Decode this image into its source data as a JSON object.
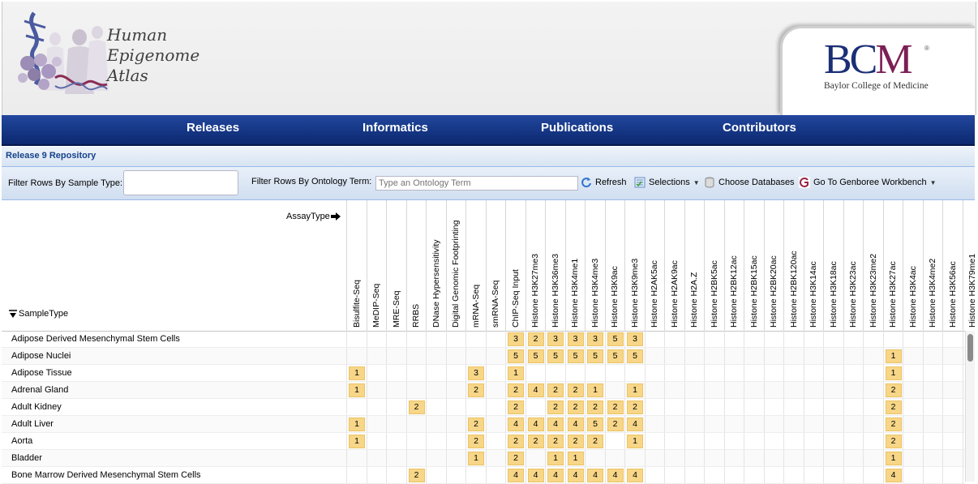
{
  "header": {
    "logo_line1": "Human",
    "logo_line2": "Epigenome",
    "logo_line3": "Atlas",
    "partner_logo": "BCM",
    "partner_name": "Baylor College of Medicine",
    "registered_mark": "®"
  },
  "nav": {
    "items": [
      "Releases",
      "Informatics",
      "Publications",
      "Contributors"
    ]
  },
  "panel": {
    "title": "Release 9 Repository"
  },
  "toolbar": {
    "sample_filter_label": "Filter Rows By Sample Type:",
    "sample_filter_value": "",
    "ontology_filter_label": "Filter Rows By Ontology Term:",
    "ontology_filter_placeholder": "Type an Ontology Term",
    "refresh_label": "Refresh",
    "selections_label": "Selections",
    "choose_databases_label": "Choose Databases",
    "genboree_label": "Go To Genboree Workbench"
  },
  "grid": {
    "assay_corner_label": "AssayType",
    "sample_corner_label": "SampleType",
    "columns": [
      "Bisulfite-Seq",
      "MeDIP-Seq",
      "MRE-Seq",
      "RRBS",
      "DNase Hypersensitivity",
      "Digital Genomic Footprinting",
      "mRNA-Seq",
      "smRNA-Seq",
      "ChIP-Seq Input",
      "Histone H3K27me3",
      "Histone H3K36me3",
      "Histone H3K4me1",
      "Histone H3K4me3",
      "Histone H3K9ac",
      "Histone H3K9me3",
      "Histone H2AK5ac",
      "Histone H2AK9ac",
      "Histone H2A.Z",
      "Histone H2BK5ac",
      "Histone H2BK12ac",
      "Histone H2BK15ac",
      "Histone H2BK20ac",
      "Histone H2BK120ac",
      "Histone H3K14ac",
      "Histone H3K18ac",
      "Histone H3K23ac",
      "Histone H3K23me2",
      "Histone H3K27ac",
      "Histone H3K4ac",
      "Histone H3K4me2",
      "Histone H3K56ac",
      "Histone H3K79me1"
    ],
    "rows": [
      {
        "label": "Adipose Derived Mesenchymal Stem Cells",
        "values": [
          "",
          "",
          "",
          "",
          "",
          "",
          "",
          "",
          "3",
          "2",
          "3",
          "3",
          "3",
          "5",
          "3",
          "",
          "",
          "",
          "",
          "",
          "",
          "",
          "",
          "",
          "",
          "",
          "",
          "",
          "",
          "",
          "",
          ""
        ]
      },
      {
        "label": "Adipose Nuclei",
        "values": [
          "",
          "",
          "",
          "",
          "",
          "",
          "",
          "",
          "5",
          "5",
          "5",
          "5",
          "5",
          "5",
          "5",
          "",
          "",
          "",
          "",
          "",
          "",
          "",
          "",
          "",
          "",
          "",
          "",
          "1",
          "",
          "",
          "",
          ""
        ]
      },
      {
        "label": "Adipose Tissue",
        "values": [
          "1",
          "",
          "",
          "",
          "",
          "",
          "3",
          "",
          "1",
          "",
          "",
          "",
          "",
          "",
          "",
          "",
          "",
          "",
          "",
          "",
          "",
          "",
          "",
          "",
          "",
          "",
          "",
          "1",
          "",
          "",
          "",
          ""
        ]
      },
      {
        "label": "Adrenal Gland",
        "values": [
          "1",
          "",
          "",
          "",
          "",
          "",
          "2",
          "",
          "2",
          "4",
          "2",
          "2",
          "1",
          "",
          "1",
          "",
          "",
          "",
          "",
          "",
          "",
          "",
          "",
          "",
          "",
          "",
          "",
          "2",
          "",
          "",
          "",
          ""
        ]
      },
      {
        "label": "Adult Kidney",
        "values": [
          "",
          "",
          "",
          "2",
          "",
          "",
          "",
          "",
          "2",
          "",
          "2",
          "2",
          "2",
          "2",
          "2",
          "",
          "",
          "",
          "",
          "",
          "",
          "",
          "",
          "",
          "",
          "",
          "",
          "2",
          "",
          "",
          "",
          ""
        ]
      },
      {
        "label": "Adult Liver",
        "values": [
          "1",
          "",
          "",
          "",
          "",
          "",
          "2",
          "",
          "4",
          "4",
          "4",
          "4",
          "5",
          "2",
          "4",
          "",
          "",
          "",
          "",
          "",
          "",
          "",
          "",
          "",
          "",
          "",
          "",
          "2",
          "",
          "",
          "",
          ""
        ]
      },
      {
        "label": "Aorta",
        "values": [
          "1",
          "",
          "",
          "",
          "",
          "",
          "2",
          "",
          "2",
          "2",
          "2",
          "2",
          "2",
          "",
          "1",
          "",
          "",
          "",
          "",
          "",
          "",
          "",
          "",
          "",
          "",
          "",
          "",
          "2",
          "",
          "",
          "",
          ""
        ]
      },
      {
        "label": "Bladder",
        "values": [
          "",
          "",
          "",
          "",
          "",
          "",
          "1",
          "",
          "2",
          "",
          "1",
          "1",
          "",
          "",
          "",
          "",
          "",
          "",
          "",
          "",
          "",
          "",
          "",
          "",
          "",
          "",
          "",
          "1",
          "",
          "",
          "",
          ""
        ]
      },
      {
        "label": "Bone Marrow Derived Mesenchymal Stem Cells",
        "values": [
          "",
          "",
          "",
          "2",
          "",
          "",
          "",
          "",
          "4",
          "4",
          "4",
          "4",
          "4",
          "4",
          "4",
          "",
          "",
          "",
          "",
          "",
          "",
          "",
          "",
          "",
          "",
          "",
          "",
          "4",
          "",
          "",
          "",
          ""
        ]
      }
    ]
  },
  "icons": {
    "refresh": "refresh-icon",
    "selections": "selections-icon",
    "databases": "database-icon",
    "genboree": "genboree-icon",
    "sort": "sort-down-icon",
    "assay_arrow": "arrow-right-icon"
  },
  "colors": {
    "nav_blue": "#173988",
    "panel_title": "#15428b",
    "cell_fill": "#f7d688",
    "bcm_blue": "#1b2f76",
    "bcm_maroon": "#7c1f56"
  }
}
